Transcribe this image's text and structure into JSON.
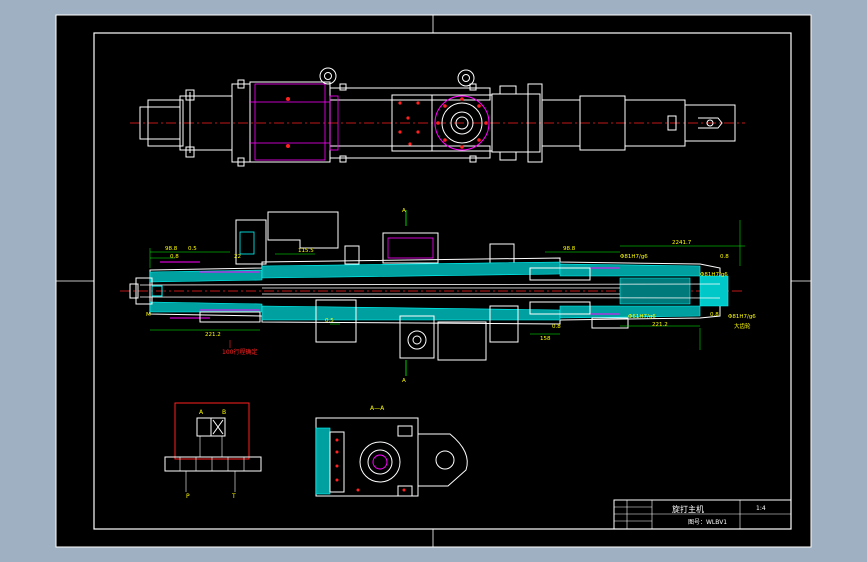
{
  "title_block": {
    "name": "旋打主机",
    "scale": "1:4",
    "drawing_no": "图号：WLBV1"
  },
  "section_labels": {
    "top_section_mark_a": "A",
    "top_section_mark_b": "A",
    "bottom_view_label": "A—A",
    "schematic_p": "P",
    "schematic_t": "T",
    "schematic_a": "A",
    "schematic_b": "B"
  },
  "dimensions": {
    "left_1": "98.8",
    "left_2": "0.5",
    "left_3": "0.8",
    "left_4": "22",
    "left_5": "M",
    "mid_1": "115.5",
    "mid_2": "4",
    "right_1": "98.8",
    "right_2": "0.8",
    "right_3": "0.5",
    "right_far": "2241.7",
    "right_d1": "0.5",
    "lower_1": "221.2",
    "lower_2": "0.8",
    "lower_3": "158",
    "lower_4": "0.5",
    "lower_right_1": "221.2",
    "lower_right_2": "0.8",
    "fit_1": "Φ81H7/g6",
    "fit_2": "Φ81H7/g6",
    "fit_3": "Φ61H7/g6",
    "fit_4": "Φ61H7/g6",
    "fit_5": "Φ81H7/g6",
    "note_red": "100行程确定",
    "note_right": "大齿轮"
  },
  "colors": {
    "sheet": "#000000",
    "frame": "#ffffff",
    "body": "#ffffff",
    "hatch": "#00c8c8",
    "hatch_fill": "#00a0a0",
    "cyan": "#00ffff",
    "magenta": "#ff00ff",
    "red": "#ff2020",
    "yellow": "#ffff00",
    "green": "#00ff00",
    "backdrop": "#9fb0c3"
  }
}
